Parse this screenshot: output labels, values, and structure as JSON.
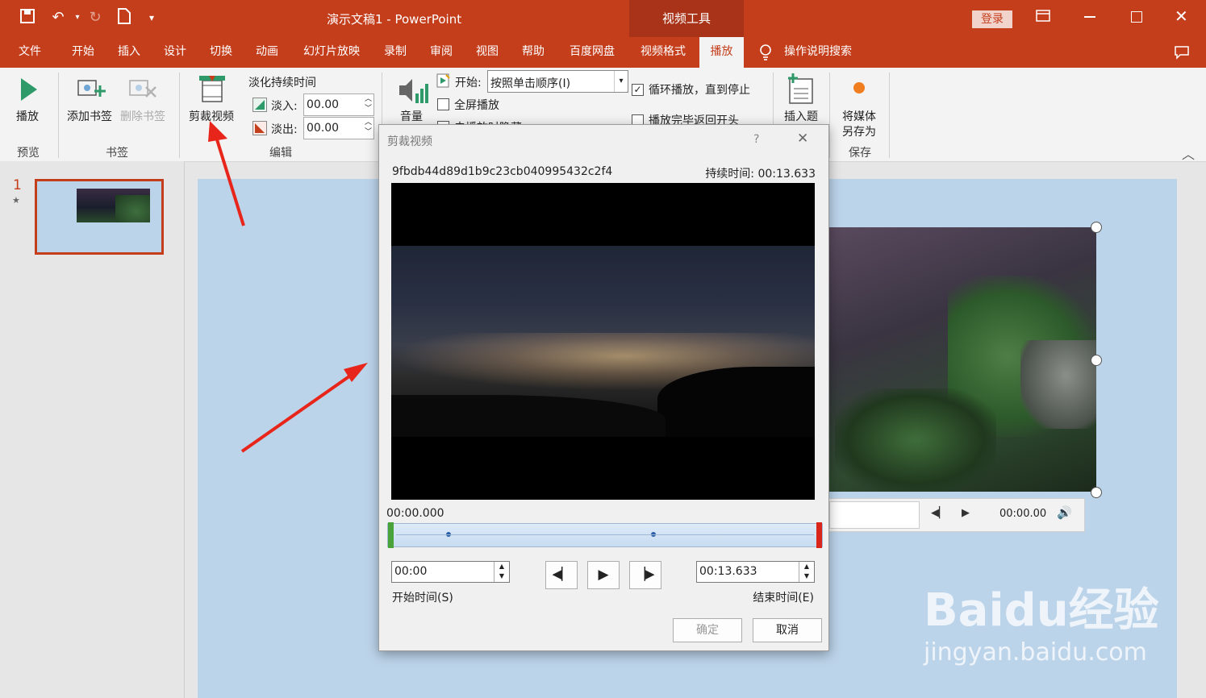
{
  "titlebar": {
    "doc_title": "演示文稿1  -  PowerPoint",
    "context_tool": "视频工具",
    "login_label": "登录"
  },
  "tabs": [
    "文件",
    "开始",
    "插入",
    "设计",
    "切换",
    "动画",
    "幻灯片放映",
    "录制",
    "审阅",
    "视图",
    "帮助",
    "百度网盘",
    "视频格式",
    "播放"
  ],
  "tell_me": "操作说明搜索",
  "ribbon": {
    "play_label": "播放",
    "preview_group": "预览",
    "add_bookmark": "添加书签",
    "remove_bookmark": "删除书签",
    "bookmark_group": "书签",
    "trim_video": "剪裁视频",
    "fade_duration": "淡化持续时间",
    "fade_in_label": "淡入:",
    "fade_in_value": "00.00",
    "fade_out_label": "淡出:",
    "fade_out_value": "00.00",
    "edit_group": "编辑",
    "volume_label": "音量",
    "start_label": "开始:",
    "start_value": "按照单击顺序(I)",
    "fullscreen": "全屏播放",
    "hide_when_not_playing": "未播放时隐藏",
    "loop": "循环播放，直到停止",
    "rewind": "播放完毕返回开头",
    "insert_caption": "插入题",
    "save_media_1": "将媒体",
    "save_media_2": "另存为",
    "save_group": "保存"
  },
  "thumbnails": [
    {
      "number": "1",
      "star": "★"
    }
  ],
  "player": {
    "time": "00:00.00"
  },
  "dialog": {
    "title": "剪裁视频",
    "help": "?",
    "filename": "9fbdb44d89d1b9c23cb040995432c2f4",
    "duration_label": "持续时间: 00:13.633",
    "current_time": "00:00.000",
    "start_time_value": "00:00",
    "start_time_label": "开始时间(S)",
    "end_time_value": "00:13.633",
    "end_time_label": "结束时间(E)",
    "ok": "确定",
    "cancel": "取消"
  },
  "watermark": {
    "line1": "Baidu经验",
    "line2": "jingyan.baidu.com"
  },
  "colors": {
    "brand": "#c43e1c",
    "slide_bg": "#bcd4ea",
    "ribbon_bg": "#f3f3f3"
  }
}
